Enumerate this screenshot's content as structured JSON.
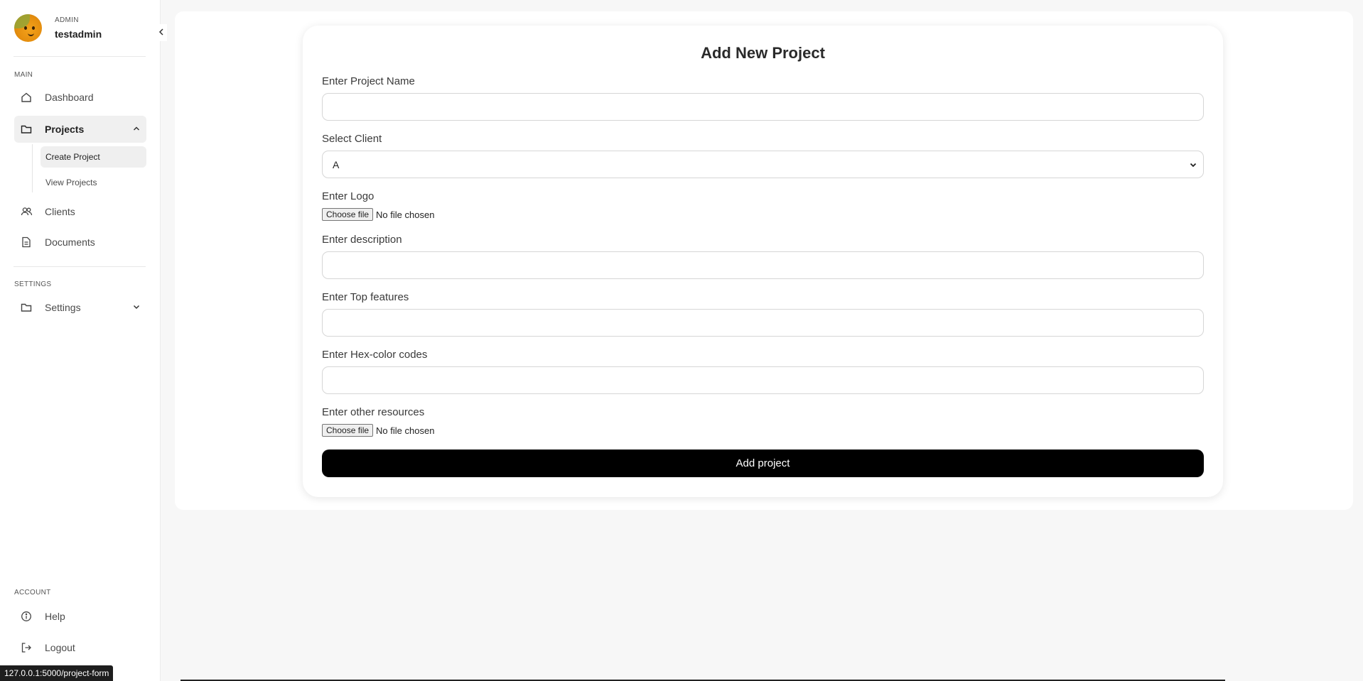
{
  "user": {
    "role": "ADMIN",
    "name": "testadmin"
  },
  "sidebar": {
    "sections": {
      "main": "MAIN",
      "settings": "SETTINGS",
      "account": "ACCOUNT"
    },
    "items": {
      "dashboard": "Dashboard",
      "projects": "Projects",
      "create_project": "Create Project",
      "view_projects": "View Projects",
      "clients": "Clients",
      "documents": "Documents",
      "settings": "Settings",
      "help": "Help",
      "logout": "Logout"
    }
  },
  "form": {
    "title": "Add New Project",
    "project_name_label": "Enter Project Name",
    "project_name_value": "",
    "client_label": "Select Client",
    "client_selected": "A",
    "logo_label": "Enter Logo",
    "choose_file": "Choose file",
    "no_file": "No file chosen",
    "description_label": "Enter description",
    "description_value": "",
    "features_label": "Enter Top features",
    "features_value": "",
    "hex_label": "Enter Hex-color codes",
    "hex_value": "",
    "resources_label": "Enter other resources",
    "submit_label": "Add project"
  },
  "status_url": "127.0.0.1:5000/project-form",
  "icons": [
    "home-icon",
    "folder-icon",
    "users-icon",
    "document-icon",
    "info-icon",
    "logout-icon",
    "chevron-left-icon",
    "chevron-up-icon",
    "chevron-down-icon"
  ]
}
